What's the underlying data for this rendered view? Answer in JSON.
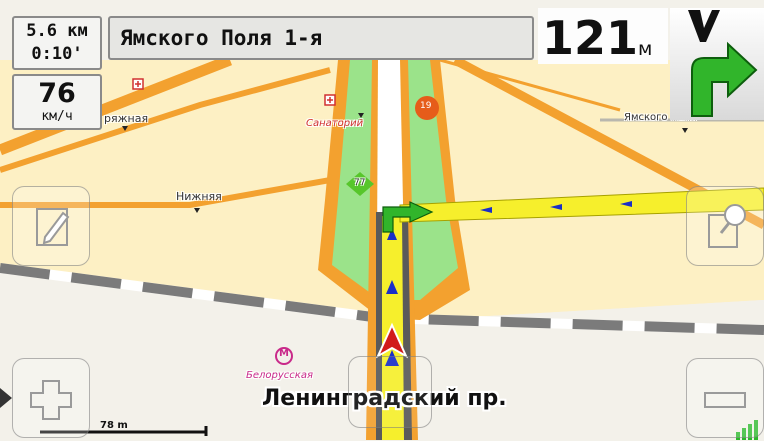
{
  "route": {
    "remaining_distance": "5.6 км",
    "remaining_time": "0:10'"
  },
  "speed": {
    "value": "76",
    "unit": "км/ч"
  },
  "street": {
    "current": "Ямского Поля 1-я"
  },
  "next_turn": {
    "distance": "121",
    "unit": "м",
    "direction": "turn-right-arrow-icon"
  },
  "map": {
    "road_label": "Ленинградский пр.",
    "labels": {
      "ryazhnaya": "ряжная",
      "nizhnyaya": "Нижняя",
      "sanatoriy": "Санаторий",
      "yamskogo": "Ямского Поля"
    },
    "road_shields": {
      "route_77": "77",
      "route_19": "19"
    },
    "metro_label": "Белорусская",
    "scale": "78 m"
  },
  "colors": {
    "route": "#f6ef2c",
    "route_arrow": "#31b52b",
    "road": "#f3a12f",
    "park": "#9be38a",
    "land": "#fdf0c4",
    "position_marker": "#d11a1a"
  },
  "icons": {
    "edit": "pencil-icon",
    "search": "map-search-icon",
    "zoom_in": "plus-icon",
    "zoom_out": "minus-icon",
    "signal": "signal-bars-icon"
  }
}
